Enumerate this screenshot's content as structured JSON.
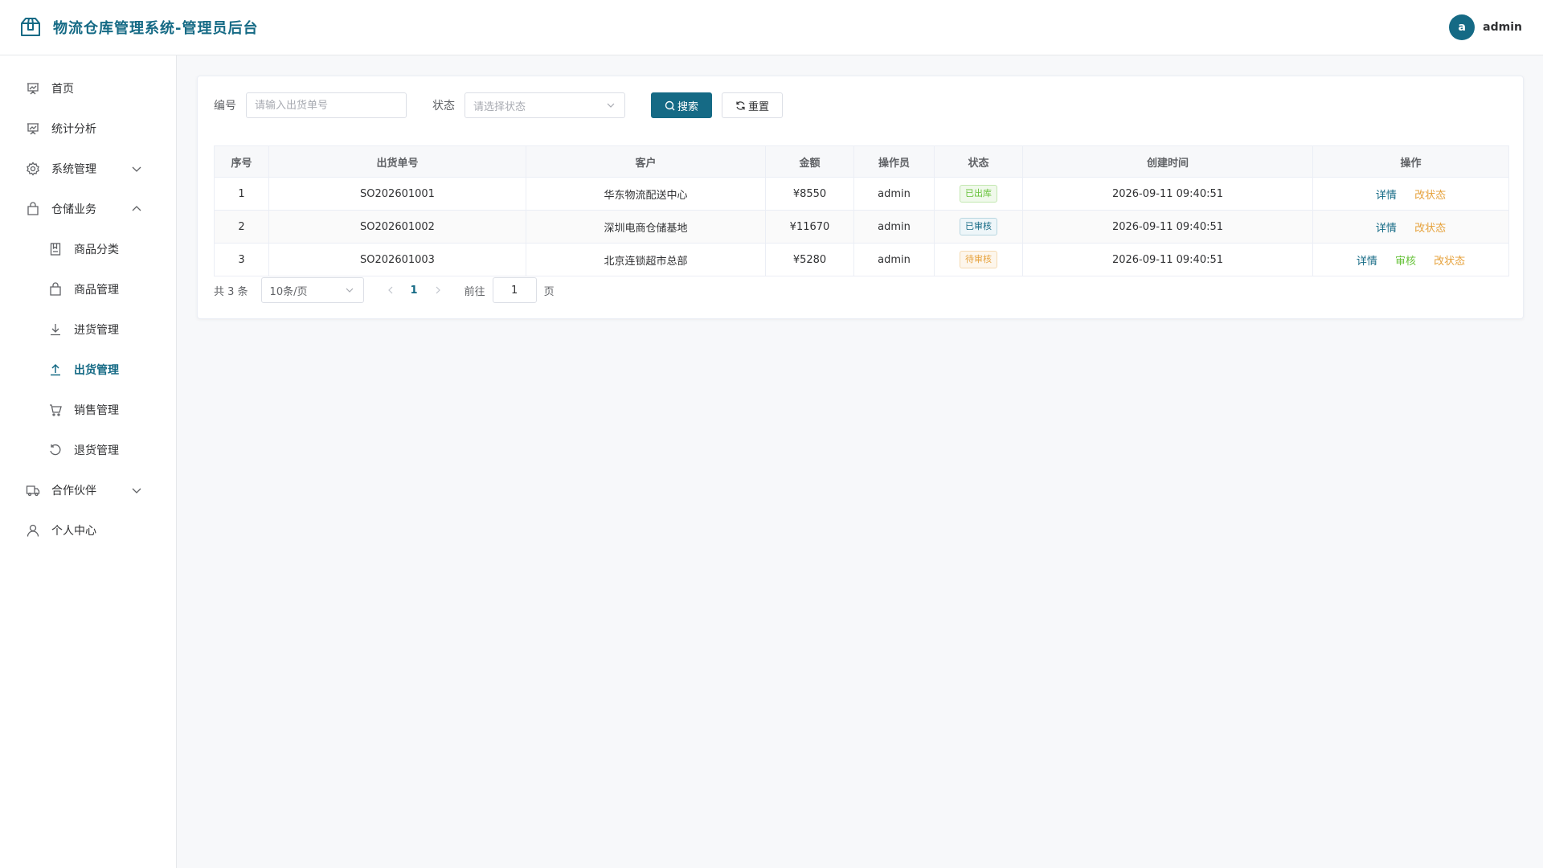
{
  "app": {
    "title": "物流仓库管理系统-管理员后台"
  },
  "user": {
    "avatar_letter": "a",
    "name": "admin"
  },
  "sidebar": {
    "items": [
      {
        "label": "首页",
        "icon": "presentation-icon"
      },
      {
        "label": "统计分析",
        "icon": "presentation-icon"
      },
      {
        "label": "系统管理",
        "icon": "gear-icon",
        "expandable": true,
        "expanded": false
      },
      {
        "label": "仓储业务",
        "icon": "bag-icon",
        "expandable": true,
        "expanded": true
      },
      {
        "label": "商品分类",
        "icon": "notebook-icon",
        "sub": true
      },
      {
        "label": "商品管理",
        "icon": "bag-icon",
        "sub": true
      },
      {
        "label": "进货管理",
        "icon": "download-icon",
        "sub": true
      },
      {
        "label": "出货管理",
        "icon": "upload-icon",
        "sub": true,
        "active": true
      },
      {
        "label": "销售管理",
        "icon": "cart-icon",
        "sub": true
      },
      {
        "label": "退货管理",
        "icon": "refresh-icon",
        "sub": true
      },
      {
        "label": "合作伙伴",
        "icon": "truck-icon",
        "expandable": true,
        "expanded": false
      },
      {
        "label": "个人中心",
        "icon": "user-icon"
      }
    ]
  },
  "search": {
    "code_label": "编号",
    "code_placeholder": "请输入出货单号",
    "status_label": "状态",
    "status_placeholder": "请选择状态",
    "search_label": "搜索",
    "reset_label": "重置"
  },
  "table": {
    "columns": [
      "序号",
      "出货单号",
      "客户",
      "金额",
      "操作员",
      "状态",
      "创建时间",
      "操作"
    ],
    "rows": [
      {
        "index": "1",
        "order_no": "SO202601001",
        "customer": "华东物流配送中心",
        "amount": "¥8550",
        "operator": "admin",
        "status": "已出库",
        "status_color": "#67c23a",
        "created": "2026-09-11 09:40:51",
        "actions": [
          "详情",
          "改状态"
        ]
      },
      {
        "index": "2",
        "order_no": "SO202601002",
        "customer": "深圳电商仓储基地",
        "amount": "¥11670",
        "operator": "admin",
        "status": "已审核",
        "status_color": "#156a85",
        "created": "2026-09-11 09:40:51",
        "actions": [
          "详情",
          "改状态"
        ]
      },
      {
        "index": "3",
        "order_no": "SO202601003",
        "customer": "北京连锁超市总部",
        "amount": "¥5280",
        "operator": "admin",
        "status": "待审核",
        "status_color": "#e6a23c",
        "created": "2026-09-11 09:40:51",
        "actions": [
          "详情",
          "审核",
          "改状态"
        ]
      }
    ]
  },
  "pagination": {
    "total_text": "共 3 条",
    "page_size": "10条/页",
    "current_page": "1",
    "goto_label": "前往",
    "goto_value": "1",
    "page_suffix": "页"
  },
  "colors": {
    "accent": "#156a85",
    "success": "#67c23a",
    "warning": "#e6a23c"
  }
}
